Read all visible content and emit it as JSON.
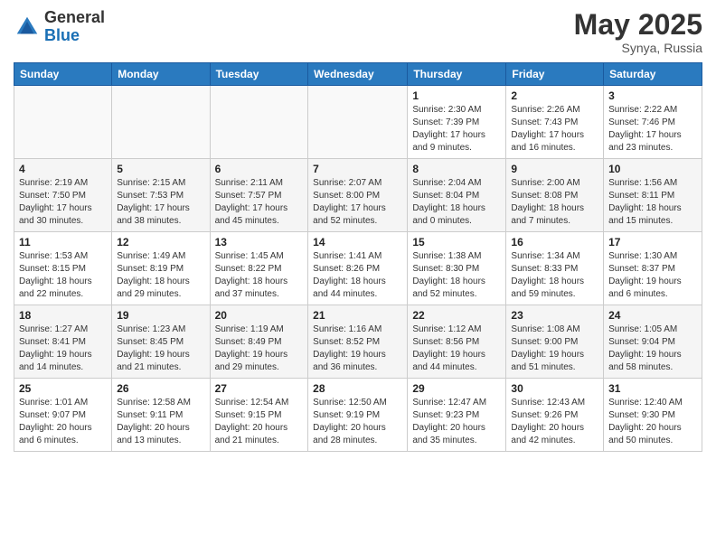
{
  "logo": {
    "general": "General",
    "blue": "Blue"
  },
  "title": "May 2025",
  "location": "Synya, Russia",
  "days_header": [
    "Sunday",
    "Monday",
    "Tuesday",
    "Wednesday",
    "Thursday",
    "Friday",
    "Saturday"
  ],
  "weeks": [
    [
      {
        "num": "",
        "info": ""
      },
      {
        "num": "",
        "info": ""
      },
      {
        "num": "",
        "info": ""
      },
      {
        "num": "",
        "info": ""
      },
      {
        "num": "1",
        "info": "Sunrise: 2:30 AM\nSunset: 7:39 PM\nDaylight: 17 hours\nand 9 minutes."
      },
      {
        "num": "2",
        "info": "Sunrise: 2:26 AM\nSunset: 7:43 PM\nDaylight: 17 hours\nand 16 minutes."
      },
      {
        "num": "3",
        "info": "Sunrise: 2:22 AM\nSunset: 7:46 PM\nDaylight: 17 hours\nand 23 minutes."
      }
    ],
    [
      {
        "num": "4",
        "info": "Sunrise: 2:19 AM\nSunset: 7:50 PM\nDaylight: 17 hours\nand 30 minutes."
      },
      {
        "num": "5",
        "info": "Sunrise: 2:15 AM\nSunset: 7:53 PM\nDaylight: 17 hours\nand 38 minutes."
      },
      {
        "num": "6",
        "info": "Sunrise: 2:11 AM\nSunset: 7:57 PM\nDaylight: 17 hours\nand 45 minutes."
      },
      {
        "num": "7",
        "info": "Sunrise: 2:07 AM\nSunset: 8:00 PM\nDaylight: 17 hours\nand 52 minutes."
      },
      {
        "num": "8",
        "info": "Sunrise: 2:04 AM\nSunset: 8:04 PM\nDaylight: 18 hours\nand 0 minutes."
      },
      {
        "num": "9",
        "info": "Sunrise: 2:00 AM\nSunset: 8:08 PM\nDaylight: 18 hours\nand 7 minutes."
      },
      {
        "num": "10",
        "info": "Sunrise: 1:56 AM\nSunset: 8:11 PM\nDaylight: 18 hours\nand 15 minutes."
      }
    ],
    [
      {
        "num": "11",
        "info": "Sunrise: 1:53 AM\nSunset: 8:15 PM\nDaylight: 18 hours\nand 22 minutes."
      },
      {
        "num": "12",
        "info": "Sunrise: 1:49 AM\nSunset: 8:19 PM\nDaylight: 18 hours\nand 29 minutes."
      },
      {
        "num": "13",
        "info": "Sunrise: 1:45 AM\nSunset: 8:22 PM\nDaylight: 18 hours\nand 37 minutes."
      },
      {
        "num": "14",
        "info": "Sunrise: 1:41 AM\nSunset: 8:26 PM\nDaylight: 18 hours\nand 44 minutes."
      },
      {
        "num": "15",
        "info": "Sunrise: 1:38 AM\nSunset: 8:30 PM\nDaylight: 18 hours\nand 52 minutes."
      },
      {
        "num": "16",
        "info": "Sunrise: 1:34 AM\nSunset: 8:33 PM\nDaylight: 18 hours\nand 59 minutes."
      },
      {
        "num": "17",
        "info": "Sunrise: 1:30 AM\nSunset: 8:37 PM\nDaylight: 19 hours\nand 6 minutes."
      }
    ],
    [
      {
        "num": "18",
        "info": "Sunrise: 1:27 AM\nSunset: 8:41 PM\nDaylight: 19 hours\nand 14 minutes."
      },
      {
        "num": "19",
        "info": "Sunrise: 1:23 AM\nSunset: 8:45 PM\nDaylight: 19 hours\nand 21 minutes."
      },
      {
        "num": "20",
        "info": "Sunrise: 1:19 AM\nSunset: 8:49 PM\nDaylight: 19 hours\nand 29 minutes."
      },
      {
        "num": "21",
        "info": "Sunrise: 1:16 AM\nSunset: 8:52 PM\nDaylight: 19 hours\nand 36 minutes."
      },
      {
        "num": "22",
        "info": "Sunrise: 1:12 AM\nSunset: 8:56 PM\nDaylight: 19 hours\nand 44 minutes."
      },
      {
        "num": "23",
        "info": "Sunrise: 1:08 AM\nSunset: 9:00 PM\nDaylight: 19 hours\nand 51 minutes."
      },
      {
        "num": "24",
        "info": "Sunrise: 1:05 AM\nSunset: 9:04 PM\nDaylight: 19 hours\nand 58 minutes."
      }
    ],
    [
      {
        "num": "25",
        "info": "Sunrise: 1:01 AM\nSunset: 9:07 PM\nDaylight: 20 hours\nand 6 minutes."
      },
      {
        "num": "26",
        "info": "Sunrise: 12:58 AM\nSunset: 9:11 PM\nDaylight: 20 hours\nand 13 minutes."
      },
      {
        "num": "27",
        "info": "Sunrise: 12:54 AM\nSunset: 9:15 PM\nDaylight: 20 hours\nand 21 minutes."
      },
      {
        "num": "28",
        "info": "Sunrise: 12:50 AM\nSunset: 9:19 PM\nDaylight: 20 hours\nand 28 minutes."
      },
      {
        "num": "29",
        "info": "Sunrise: 12:47 AM\nSunset: 9:23 PM\nDaylight: 20 hours\nand 35 minutes."
      },
      {
        "num": "30",
        "info": "Sunrise: 12:43 AM\nSunset: 9:26 PM\nDaylight: 20 hours\nand 42 minutes."
      },
      {
        "num": "31",
        "info": "Sunrise: 12:40 AM\nSunset: 9:30 PM\nDaylight: 20 hours\nand 50 minutes."
      }
    ]
  ]
}
